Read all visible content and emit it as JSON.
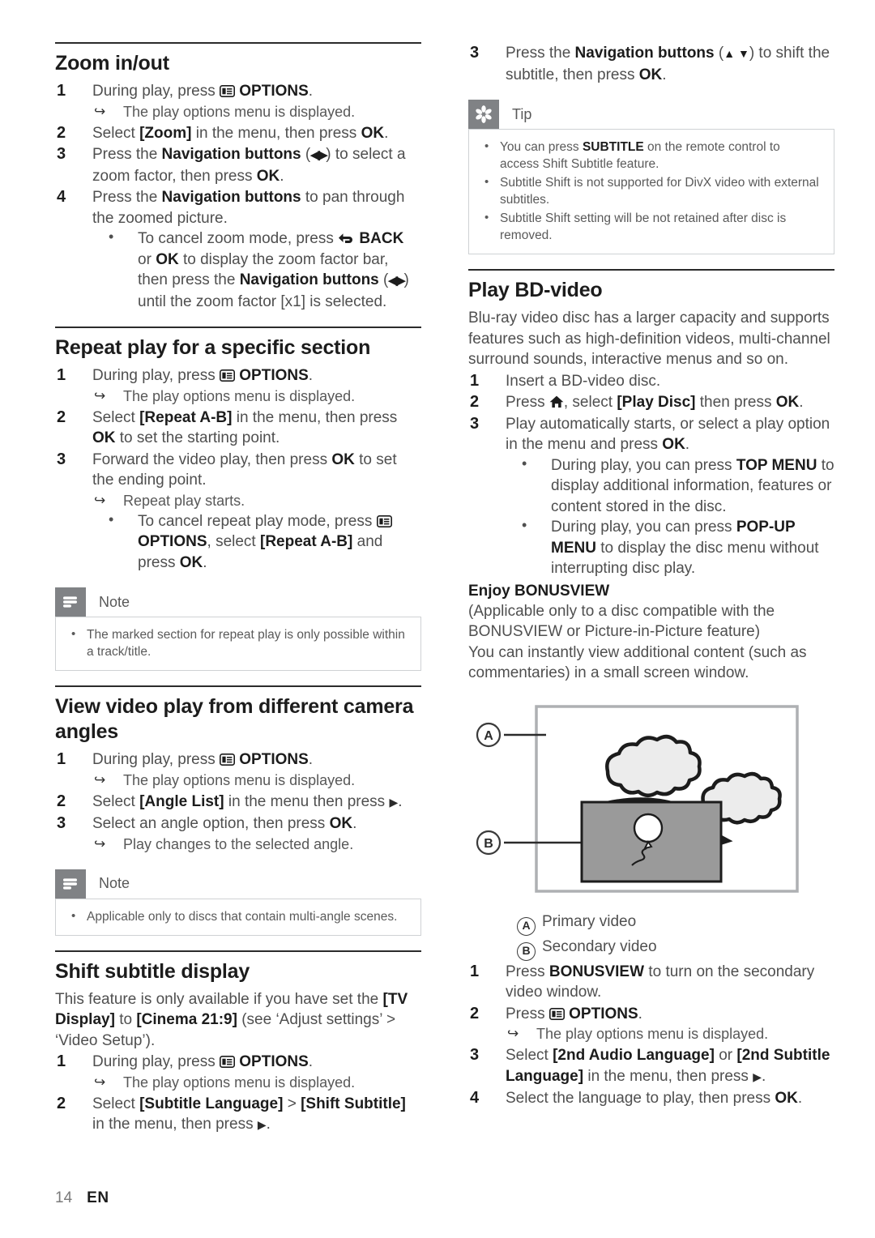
{
  "page": {
    "number": "14",
    "language": "EN"
  },
  "icons": {
    "options": "options-icon",
    "home": "home-icon",
    "back": "back-icon",
    "nav_lr": "◀▶",
    "nav_ud": "▲ ▼",
    "right": "▶",
    "arrow_result": "↪",
    "bullet": "•"
  },
  "left": {
    "zoom": {
      "heading": "Zoom in/out",
      "steps": [
        {
          "num": "1",
          "pre": "During play, press ",
          "icon": "options",
          "post": " OPTIONS.",
          "post_bold": "OPTIONS",
          "result": "The play options menu is displayed."
        },
        {
          "num": "2",
          "text": "Select [Zoom] in the menu, then press OK."
        },
        {
          "num": "3",
          "text": "Press the Navigation buttons (◀▶) to select a zoom factor, then press OK."
        },
        {
          "num": "4",
          "text": "Press the Navigation buttons to pan through the zoomed picture."
        }
      ],
      "sub_bullet": "To cancel zoom mode, press ↶ BACK or OK to display the zoom factor bar, then press the Navigation buttons (◀▶) until the zoom factor [x1] is selected."
    },
    "repeat": {
      "heading": "Repeat play for a specific section",
      "step1_pre": "During play, press ",
      "step1_post": " OPTIONS.",
      "step1_result": "The play options menu is displayed.",
      "step2": "Select [Repeat A-B] in the menu, then press OK to set the starting point.",
      "step3": "Forward the video play, then press OK to set the ending point.",
      "step3_result": "Repeat play starts.",
      "step3_bullet": "To cancel repeat play mode, press ▤ OPTIONS, select [Repeat A-B] and press OK.",
      "note": {
        "title": "Note",
        "items": [
          "The marked section for repeat play is only possible within a track/title."
        ]
      }
    },
    "angles": {
      "heading": "View video play from different camera angles",
      "step1_result": "The play options menu is displayed.",
      "step2": "Select [Angle List] in the menu then press ▶.",
      "step3": "Select an angle option, then press OK.",
      "step3_result": "Play changes to the selected angle.",
      "note": {
        "title": "Note",
        "items": [
          "Applicable only to discs that contain multi-angle scenes."
        ]
      }
    },
    "shift": {
      "heading": "Shift subtitle display",
      "intro": "This feature is only available if you have set the [TV Display] to [Cinema 21:9] (see ‘Adjust settings’ > ‘Video Setup’).",
      "step1_result": "The play options menu is displayed.",
      "step2": "Select [Subtitle Language] > [Shift Subtitle] in the menu, then press ▶."
    }
  },
  "right": {
    "shift_cont": {
      "step3": "Press the Navigation buttons (▲ ▼) to shift the subtitle, then press OK."
    },
    "tip": {
      "title": "Tip",
      "items": [
        "You can press SUBTITLE on the remote control to access Shift Subtitle feature.",
        "Subtitle Shift is not supported for DivX video with external subtitles.",
        "Subtitle Shift setting will be not retained after disc is removed."
      ]
    },
    "bd": {
      "heading": "Play BD-video",
      "intro": "Blu-ray video disc has a larger capacity and supports features such as high-definition videos, multi-channel surround sounds, interactive menus and so on.",
      "step1": "Insert a BD-video disc.",
      "step2_pre": "Press ",
      "step2_post": ", select [Play Disc] then press OK.",
      "step3": "Play automatically starts, or select a play option in the menu and press OK.",
      "bullets": [
        "During play, you can press TOP MENU to display additional information, features or content stored in the disc.",
        "During play, you can press POP-UP MENU to display the disc menu without interrupting disc play."
      ]
    },
    "bonusview": {
      "heading": "Enjoy BONUSVIEW",
      "paren": "(Applicable only to a disc compatible with the BONUSVIEW or Picture-in-Picture feature)",
      "body": "You can instantly view additional content (such as commentaries) in a small screen window.",
      "figure": {
        "label_a": "A",
        "label_b": "B"
      },
      "legend": [
        {
          "key": "A",
          "text": "Primary video"
        },
        {
          "key": "B",
          "text": "Secondary video"
        }
      ],
      "steps": [
        {
          "num": "1",
          "text": "Press BONUSVIEW to turn on the secondary video window."
        },
        {
          "num": "2",
          "pre": "Press ",
          "post": " OPTIONS.",
          "result": "The play options menu is displayed."
        },
        {
          "num": "3",
          "text": "Select [2nd Audio Language] or [2nd Subtitle Language] in the menu, then press ▶."
        },
        {
          "num": "4",
          "text": "Select the language to play, then press OK."
        }
      ]
    }
  }
}
